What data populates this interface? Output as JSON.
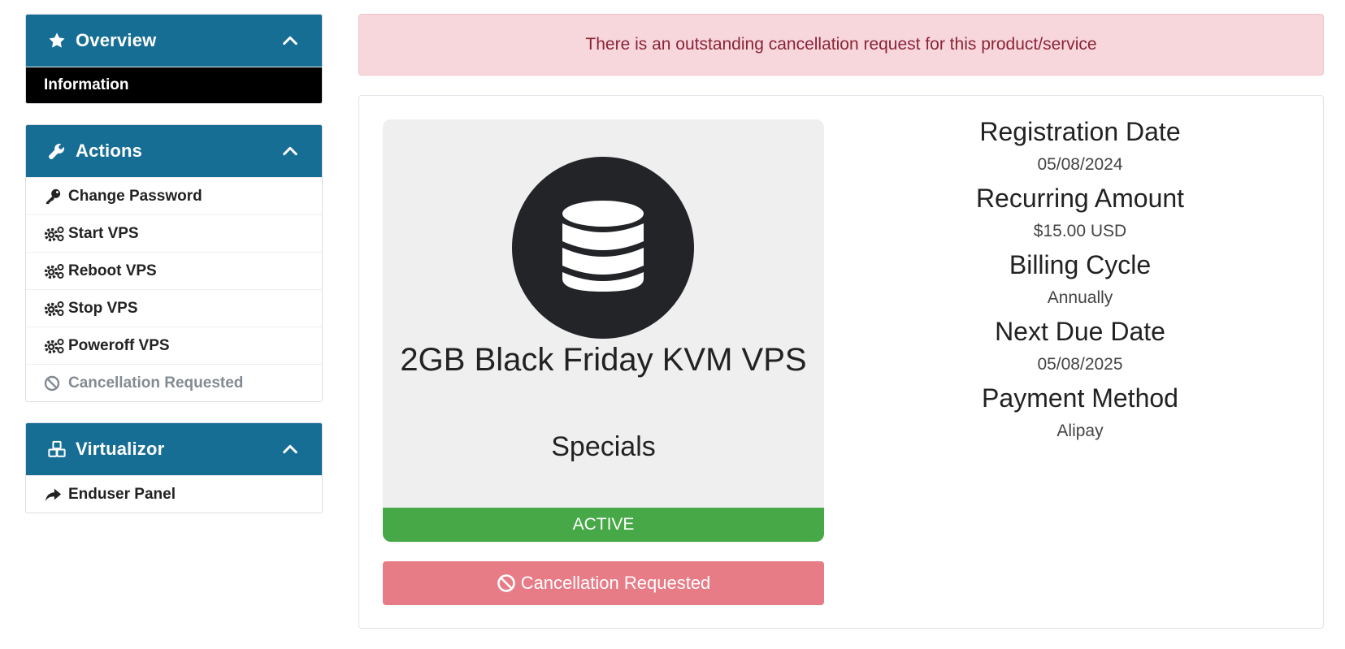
{
  "sidebar": {
    "overview": {
      "title": "Overview",
      "icon": "star-icon",
      "items": [
        {
          "label": "Information",
          "active": true
        }
      ]
    },
    "actions": {
      "title": "Actions",
      "icon": "wrench-icon",
      "items": [
        {
          "label": "Change Password",
          "icon": "key-icon"
        },
        {
          "label": "Start VPS",
          "icon": "cogs-icon"
        },
        {
          "label": "Reboot VPS",
          "icon": "cogs-icon"
        },
        {
          "label": "Stop VPS",
          "icon": "cogs-icon"
        },
        {
          "label": "Poweroff VPS",
          "icon": "cogs-icon"
        },
        {
          "label": "Cancellation Requested",
          "icon": "ban-icon",
          "disabled": true
        }
      ]
    },
    "virtualizor": {
      "title": "Virtualizor",
      "icon": "cubes-icon",
      "items": [
        {
          "label": "Enduser Panel",
          "icon": "share-icon"
        }
      ]
    }
  },
  "alert": {
    "text": "There is an outstanding cancellation request for this product/service"
  },
  "product": {
    "name": "2GB Black Friday KVM VPS",
    "group": "Specials",
    "status": "ACTIVE",
    "icon": "database-icon",
    "cancel_label": "Cancellation Requested"
  },
  "details": [
    {
      "label": "Registration Date",
      "value": "05/08/2024"
    },
    {
      "label": "Recurring Amount",
      "value": "$15.00 USD"
    },
    {
      "label": "Billing Cycle",
      "value": "Annually"
    },
    {
      "label": "Next Due Date",
      "value": "05/08/2025"
    },
    {
      "label": "Payment Method",
      "value": "Alipay"
    }
  ],
  "colors": {
    "panel_header": "#176e95",
    "alert_bg": "#f8d7dc",
    "alert_text": "#8a2436",
    "status_active": "#46a846",
    "cancel_button": "#e77c87"
  }
}
